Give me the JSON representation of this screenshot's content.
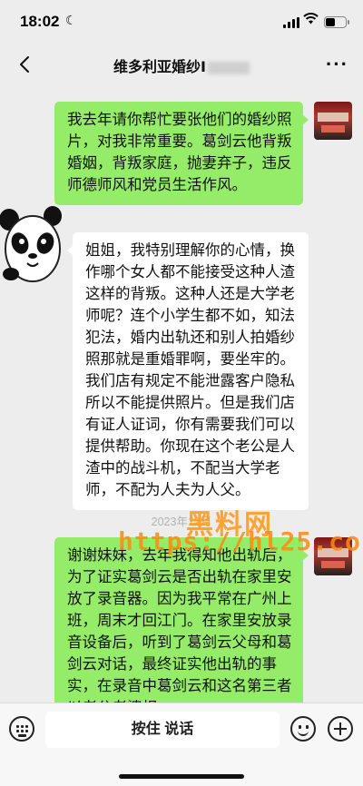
{
  "status_bar": {
    "time": "18:02",
    "battery_level": 0.5
  },
  "nav": {
    "title": "维多利亚婚纱Ⅰ"
  },
  "messages": [
    {
      "side": "right",
      "text": "我去年请你帮忙要张他们的婚纱照片，对我非常重要。葛剑云他背叛婚姻，背叛家庭，抛妻弃子，违反师德师风和党员生活作风。"
    },
    {
      "side": "left",
      "text": "姐姐，我特别理解你的心情，换作哪个女人都不能接受这种人渣这样的背叛。这种人还是大学老师呢？连个小学生都不如，知法犯法，婚内出轨还和别人拍婚纱照那就是重婚罪啊，要坐牢的。我们店有规定不能泄露客户隐私所以不能提供照片。但是我们店有证人证词，你有需要我们可以提供帮助。你现在这个老公是人渣中的战斗机，不配当大学老师，不配为人夫为人父。"
    },
    {
      "side": "right",
      "text": "谢谢妹妹，去年我得知他出轨后，为了证实葛剑云是否出轨在家里安放了录音器。因为我平常在广州上班，周末才回江门。在家里安放录音设备后，听到了葛剑云父母和葛剑云对话，最终证实他出轨的事实，在录音中葛剑云和这名第三者以老公老婆相"
    }
  ],
  "timestamp": "2023年12月",
  "watermark": {
    "line1": "黑料网",
    "line2": "https://hl25.co"
  },
  "input_bar": {
    "hold_to_talk": "按住 说话"
  }
}
